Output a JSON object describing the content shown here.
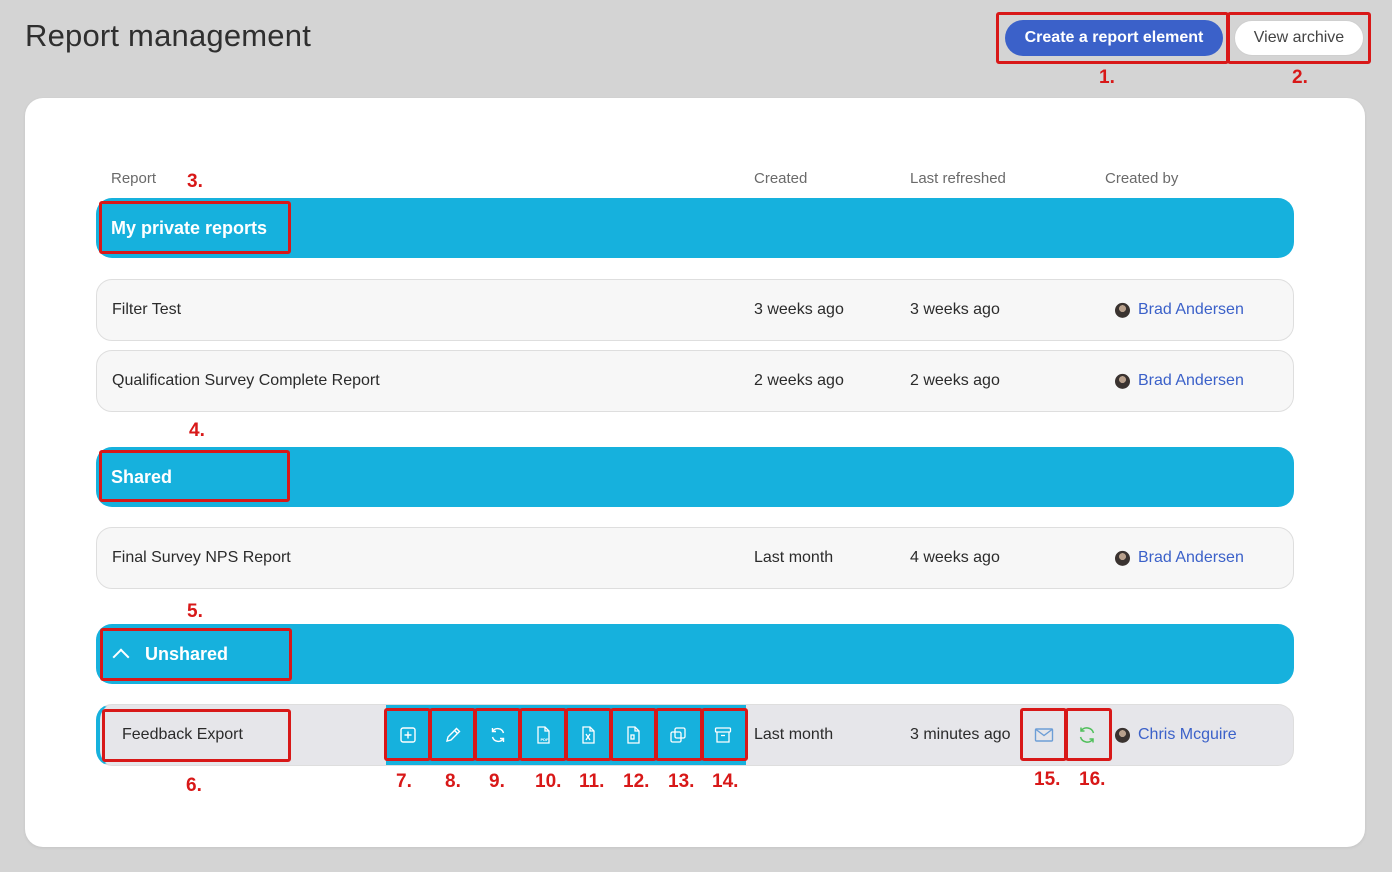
{
  "page": {
    "title": "Report management"
  },
  "actions": {
    "create_label": "Create a report element",
    "archive_label": "View archive"
  },
  "table": {
    "headers": {
      "report": "Report",
      "created": "Created",
      "last_refreshed": "Last refreshed",
      "created_by": "Created by"
    }
  },
  "groups": {
    "private": {
      "label": "My private reports",
      "rows": [
        {
          "name": "Filter Test",
          "created": "3 weeks ago",
          "refreshed": "3 weeks ago",
          "author": "Brad Andersen"
        },
        {
          "name": "Qualification Survey Complete Report",
          "created": "2 weeks ago",
          "refreshed": "2 weeks ago",
          "author": "Brad Andersen"
        }
      ]
    },
    "shared": {
      "label": "Shared",
      "rows": [
        {
          "name": "Final Survey NPS Report",
          "created": "Last month",
          "refreshed": "4 weeks ago",
          "author": "Brad Andersen"
        }
      ]
    },
    "unshared": {
      "label": "Unshared",
      "rows": [
        {
          "name": "Feedback Export",
          "created": "Last month",
          "refreshed": "3 minutes ago",
          "author": "Chris Mcguire"
        }
      ]
    }
  },
  "row_tools": [
    {
      "icon": "add-element-icon"
    },
    {
      "icon": "pencil-icon"
    },
    {
      "icon": "refresh-icon"
    },
    {
      "icon": "pdf-file-icon"
    },
    {
      "icon": "excel-file-icon"
    },
    {
      "icon": "document-file-icon"
    },
    {
      "icon": "duplicate-icon"
    },
    {
      "icon": "archive-icon"
    }
  ],
  "row_extras": [
    {
      "icon": "envelope-icon",
      "color": "#6d9ed6"
    },
    {
      "icon": "auto-refresh-icon",
      "color": "#4fbf5a"
    }
  ],
  "annotations": [
    "1.",
    "2.",
    "3.",
    "4.",
    "5.",
    "6.",
    "7.",
    "8.",
    "9.",
    "10.",
    "11.",
    "12.",
    "13.",
    "14.",
    "15.",
    "16."
  ],
  "colors": {
    "accent": "#16b1dd",
    "primary_button": "#3b61c9",
    "annotation": "#d81818"
  }
}
